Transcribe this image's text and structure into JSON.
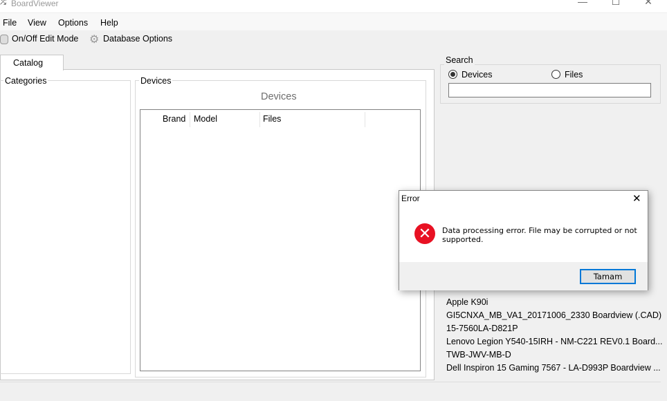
{
  "window": {
    "title": "BoardViewer",
    "minimize": "—",
    "maximize": "☐",
    "close": "✕",
    "app_icon": "shuffle-icon"
  },
  "menu": [
    "File",
    "View",
    "Options",
    "Help"
  ],
  "toolbar": {
    "edit_mode": "On/Off Edit Mode",
    "database_options": "Database Options"
  },
  "tabs": [
    {
      "label": "Catalog",
      "active": true
    }
  ],
  "categories": {
    "label": "Categories"
  },
  "devices": {
    "group_label": "Devices",
    "header": "Devices",
    "columns": [
      "Brand",
      "Model",
      "Files"
    ]
  },
  "search": {
    "label": "Search",
    "options": [
      {
        "label": "Devices",
        "selected": true
      },
      {
        "label": "Files",
        "selected": false
      }
    ],
    "value": ""
  },
  "recent_files": [
    "Apple K90i",
    "GI5CNXA_MB_VA1_20171006_2330 Boardview (.CAD)",
    "15-7560LA-D821P",
    "Lenovo Legion Y540-15IRH - NM-C221 REV0.1 Board...",
    "TWB-JWV-MB-D",
    "Dell Inspiron 15 Gaming 7567  - LA-D993P Boardview ..."
  ],
  "dialog": {
    "title": "Error",
    "message_line1": "Data processing error. File may be corrupted or not",
    "message_line2": "supported.",
    "ok": "Tamam",
    "close": "✕",
    "icon": "error-icon",
    "icon_color": "#e81123"
  }
}
